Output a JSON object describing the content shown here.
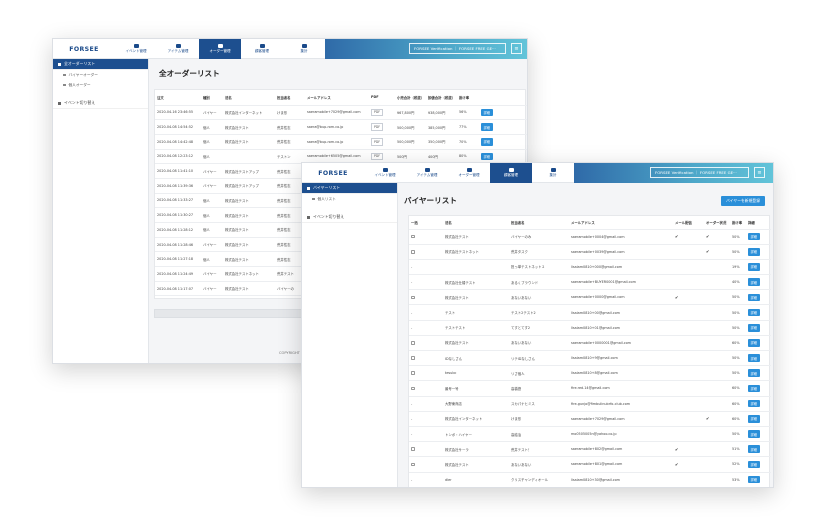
{
  "win1": {
    "logo": "FORSEE",
    "nav": [
      {
        "label": "イベント管理",
        "icon": "flag-icon"
      },
      {
        "label": "アイテム管理",
        "icon": "items-icon"
      },
      {
        "label": "オーダー管理",
        "icon": "order-icon"
      },
      {
        "label": "顧客管理",
        "icon": "customer-icon"
      },
      {
        "label": "集計",
        "icon": "chart-icon"
      }
    ],
    "header_badge": "FORSEE Verification ｜ FORSEE FREE GE···",
    "menu_glyph": "≡",
    "sidebar": {
      "active": "全オーダーリスト",
      "sub1": "バイヤーオーダー",
      "sub2": "個人オーダー",
      "event_switch": "イベント切り替え"
    },
    "title": "全オーダーリスト",
    "columns": [
      "注文",
      "種別",
      "法名",
      "担当者名",
      "メールアドレス",
      "PDF",
      "小売合計（税抜）",
      "卸値合計（税抜）",
      "掛け率",
      ""
    ],
    "rows": [
      [
        "2020-04-16 23:46:55",
        "バイヤー",
        "株式会社インターネット",
        "けま形",
        "saeramobile+7029@gmail.com",
        "PDF",
        "¥67,800円",
        "¥38,000円",
        "56%",
        "詳細"
      ],
      [
        "2020-04-08 14:54:52",
        "個人",
        "株式会社テスト",
        "荒井性志",
        "saera@bup-rom.co.jp",
        "PDF",
        "500,000円",
        "385,000円",
        "77%",
        "詳細"
      ],
      [
        "2020-04-08 14:42:48",
        "個人",
        "株式会社テスト",
        "荒井性志",
        "saera@bup-rom.co.jp",
        "PDF",
        "500,000円",
        "350,000円",
        "70%",
        "詳細"
      ],
      [
        "2020-04-08 12:23:12",
        "個人",
        "",
        "テストン",
        "saeramobile+6505@gmail.com",
        "PDF",
        "500円",
        "400円",
        "80%",
        "詳細"
      ],
      [
        "2020-04-08 11:41:10",
        "バイヤー",
        "株式会社テストアップ",
        "荒井性志",
        "",
        "",
        "",
        "",
        "",
        ""
      ],
      [
        "2020-04-08 11:39:36",
        "バイヤー",
        "株式会社テストアップ",
        "荒井性志",
        "",
        "",
        "",
        "",
        "",
        ""
      ],
      [
        "2020-04-08 11:33:27",
        "個人",
        "株式会社テスト",
        "荒井性志",
        "",
        "",
        "",
        "",
        "",
        ""
      ],
      [
        "2020-04-08 11:30:27",
        "個人",
        "株式会社テスト",
        "荒井性志",
        "",
        "",
        "",
        "",
        "",
        ""
      ],
      [
        "2020-04-08 11:28:12",
        "個人",
        "株式会社テスト",
        "荒井性志",
        "",
        "",
        "",
        "",
        "",
        ""
      ],
      [
        "2020-04-08 11:28:46",
        "バイヤー",
        "株式会社テスト",
        "荒井性志",
        "",
        "",
        "",
        "",
        "",
        ""
      ],
      [
        "2020-04-08 11:27:18",
        "個人",
        "株式会社テスト",
        "荒井性志",
        "",
        "",
        "",
        "",
        "",
        ""
      ],
      [
        "2020-04-08 11:24:49",
        "バイヤー",
        "株式会社テストネット",
        "荒井テスト",
        "",
        "",
        "",
        "",
        "",
        ""
      ],
      [
        "2020-04-08 11:17:07",
        "バイヤー",
        "株式会社テスト",
        "バイヤーの",
        "",
        "",
        "",
        "",
        "",
        ""
      ]
    ],
    "footer": "COPYRIGHT"
  },
  "win2": {
    "logo": "FORSEE",
    "nav": [
      {
        "label": "イベント管理",
        "icon": "flag-icon"
      },
      {
        "label": "アイテム管理",
        "icon": "items-icon"
      },
      {
        "label": "オーダー管理",
        "icon": "order-icon"
      },
      {
        "label": "顧客管理",
        "icon": "customer-icon"
      },
      {
        "label": "集計",
        "icon": "chart-icon"
      }
    ],
    "header_badge": "FORSEE Verification ｜ FORSEE FREE GE···",
    "menu_glyph": "≡",
    "sidebar": {
      "active": "バイヤーリスト",
      "sub1": "個人リスト",
      "event_switch": "イベント切り替え"
    },
    "title": "バイヤーリスト",
    "new_button": "バイヤーを新規登録",
    "columns": [
      "一括",
      "法名",
      "担当者名",
      "メールアドレス",
      "メール配信",
      "オーダー状況",
      "掛け率",
      "詳細"
    ],
    "rows": [
      [
        "",
        "株式会社テスト",
        "バイヤーのみ",
        "saeramobile+0004@gmail.com",
        "✔",
        "✔",
        "50%",
        "詳細"
      ],
      [
        "",
        "株式会社テストネット",
        "荒井タスク",
        "saeramobile+0039@gmail.com",
        "",
        "✔",
        "50%",
        "詳細"
      ],
      [
        "-",
        "",
        "担っ単テストネット２",
        "lisaiam0810+000@gmail.com",
        "",
        "",
        "19%",
        "詳細"
      ],
      [
        "-",
        "株式会社仕椿テスト",
        "あるくブラウンド",
        "saeramobile+BUYER0001@gmail.com",
        "",
        "",
        "40%",
        "詳細"
      ],
      [
        "",
        "株式会社テスト",
        "あないあない",
        "saeramobile+0000@gmail.com",
        "✔",
        "",
        "50%",
        "詳細"
      ],
      [
        "-",
        "テスト",
        "テスト2テスト2",
        "lisaiam0810+00@gmail.com",
        "",
        "",
        "50%",
        "詳細"
      ],
      [
        "-",
        "テストテスト",
        "てすとてす2",
        "lisaiam0810+01@gmail.com",
        "",
        "",
        "50%",
        "詳細"
      ],
      [
        "",
        "株式会社テスト",
        "あないあない",
        "saeramobile+0000001@gmail.com",
        "",
        "",
        "60%",
        "詳細"
      ],
      [
        "",
        "IDなしさん",
        "リテIDなしさん",
        "lisaiam0810+9@gmail.com",
        "",
        "",
        "50%",
        "詳細"
      ],
      [
        "",
        "tesubc",
        "リさ個人",
        "lisaiam0810+8@gmail.com",
        "",
        "",
        "50%",
        "詳細"
      ],
      [
        "",
        "最号一号",
        "高橋啓",
        "fire.red.14@gmail.com",
        "",
        "",
        "60%",
        "詳細"
      ],
      [
        "-",
        "大野東商店",
        "スカパナヒミス",
        "fire-gunjo@fimbulinubrfo-club.com",
        "",
        "",
        "60%",
        "詳細"
      ],
      [
        "-",
        "株式会社インターネット",
        "けま形",
        "saeramobile+7029@gmail.com",
        "",
        "✔",
        "60%",
        "詳細"
      ],
      [
        "-",
        "トンボ・ハイヤー",
        "高結治",
        "mo0505005n@yahoo.co.jp",
        "",
        "",
        "50%",
        "詳細"
      ],
      [
        "",
        "株式会社サーラ",
        "荒井テスト！",
        "saeramobile+802@gmail.com",
        "✔",
        "",
        "51%",
        "詳細"
      ],
      [
        "",
        "株式会社テスト",
        "あないあない",
        "saeramobile+801@gmail.com",
        "✔",
        "",
        "52%",
        "詳細"
      ],
      [
        "-",
        "dler",
        "クリスチャンディオール",
        "lisaiam0810+30@gmail.com",
        "",
        "",
        "53%",
        "詳細"
      ]
    ]
  }
}
